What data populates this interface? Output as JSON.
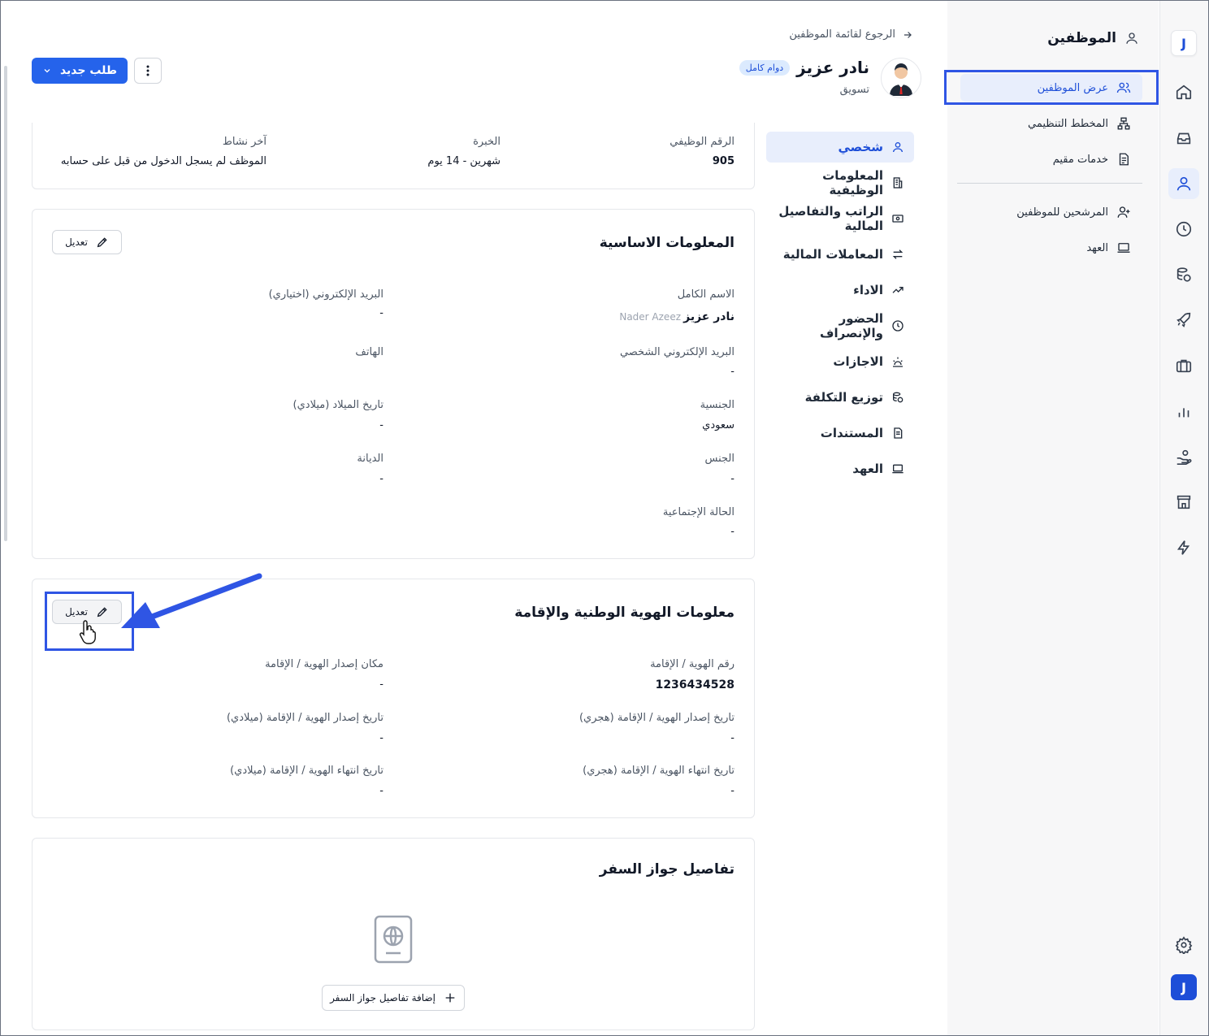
{
  "rail": {
    "logo_letter": "J",
    "icons": [
      "home-icon",
      "inbox-icon",
      "user-icon",
      "clock-icon",
      "coins-icon",
      "rocket-icon",
      "briefcase-icon",
      "chart-icon",
      "hand-coin-icon",
      "store-icon",
      "bolt-icon",
      "settings-icon"
    ],
    "active": "user-icon"
  },
  "subnav": {
    "title": "الموظفين",
    "items": [
      {
        "label": "عرض الموظفين",
        "icon": "users-icon",
        "active": true
      },
      {
        "label": "المخطط التنظيمي",
        "icon": "org-chart-icon"
      },
      {
        "label": "خدمات مقيم",
        "icon": "document-icon"
      },
      {
        "label": "المرشحين للموظفين",
        "icon": "user-plus-icon"
      },
      {
        "label": "العهد",
        "icon": "laptop-icon"
      }
    ]
  },
  "header": {
    "back_label": "الرجوع لقائمة الموظفين",
    "employee_name": "نادر عزيز",
    "employment_badge": "دوام كامل",
    "department": "تسويق",
    "new_request_label": "طلب جديد"
  },
  "section_nav": [
    {
      "label": "شخصي",
      "icon": "user-icon",
      "active": true
    },
    {
      "label": "المعلومات الوظيفية",
      "icon": "building-icon"
    },
    {
      "label": "الراتب والتفاصيل المالية",
      "icon": "money-icon"
    },
    {
      "label": "المعاملات المالية",
      "icon": "transfer-icon"
    },
    {
      "label": "الاداء",
      "icon": "trend-icon"
    },
    {
      "label": "الحضور والإنصراف",
      "icon": "clock-icon"
    },
    {
      "label": "الاجازات",
      "icon": "sun-icon"
    },
    {
      "label": "توزيع التكلفة",
      "icon": "coins-icon"
    },
    {
      "label": "المستندات",
      "icon": "document-icon"
    },
    {
      "label": "العهد",
      "icon": "laptop-icon"
    }
  ],
  "summary": {
    "employee_id_label": "الرقم الوظيفي",
    "employee_id": "905",
    "experience_label": "الخبرة",
    "experience": "شهرين - 14 يوم",
    "last_activity_label": "آخر نشاط",
    "last_activity": "الموظف لم يسجل الدخول من قبل على حسابه"
  },
  "basic_info": {
    "title": "المعلومات الاساسية",
    "edit_label": "تعديل",
    "full_name_label": "الاسم الكامل",
    "full_name": "نادر عزيز",
    "full_name_en": "Nader Azeez",
    "optional_email_label": "البريد الإلكتروني (اختياري)",
    "optional_email": "-",
    "personal_email_label": "البريد الإلكتروني الشخصي",
    "personal_email": "-",
    "phone_label": "الهاتف",
    "nationality_label": "الجنسية",
    "nationality": "سعودي",
    "birth_date_label": "تاريخ الميلاد (ميلادي)",
    "birth_date": "-",
    "gender_label": "الجنس",
    "gender": "-",
    "religion_label": "الديانة",
    "religion": "-",
    "marital_label": "الحالة الإجتماعية",
    "marital": "-"
  },
  "id_info": {
    "title": "معلومات الهوية الوطنية والإقامة",
    "edit_label": "تعديل",
    "id_number_label": "رقم الهوية / الإقامة",
    "id_number": "1236434528",
    "issue_place_label": "مكان إصدار الهوية / الإقامة",
    "issue_place": "-",
    "issue_date_hijri_label": "تاريخ إصدار الهوية / الإقامة (هجري)",
    "issue_date_hijri": "-",
    "issue_date_greg_label": "تاريخ إصدار الهوية / الإقامة (ميلادي)",
    "issue_date_greg": "-",
    "expiry_hijri_label": "تاريخ انتهاء الهوية / الإقامة (هجري)",
    "expiry_hijri": "-",
    "expiry_greg_label": "تاريخ انتهاء الهوية / الإقامة (ميلادي)",
    "expiry_greg": "-"
  },
  "passport": {
    "title": "تفاصيل جواز السفر",
    "add_label": "إضافة تفاصيل جواز السفر"
  },
  "colors": {
    "accent": "#2563eb",
    "annotation": "#2f55e4",
    "active_bg": "#e8eefc"
  }
}
